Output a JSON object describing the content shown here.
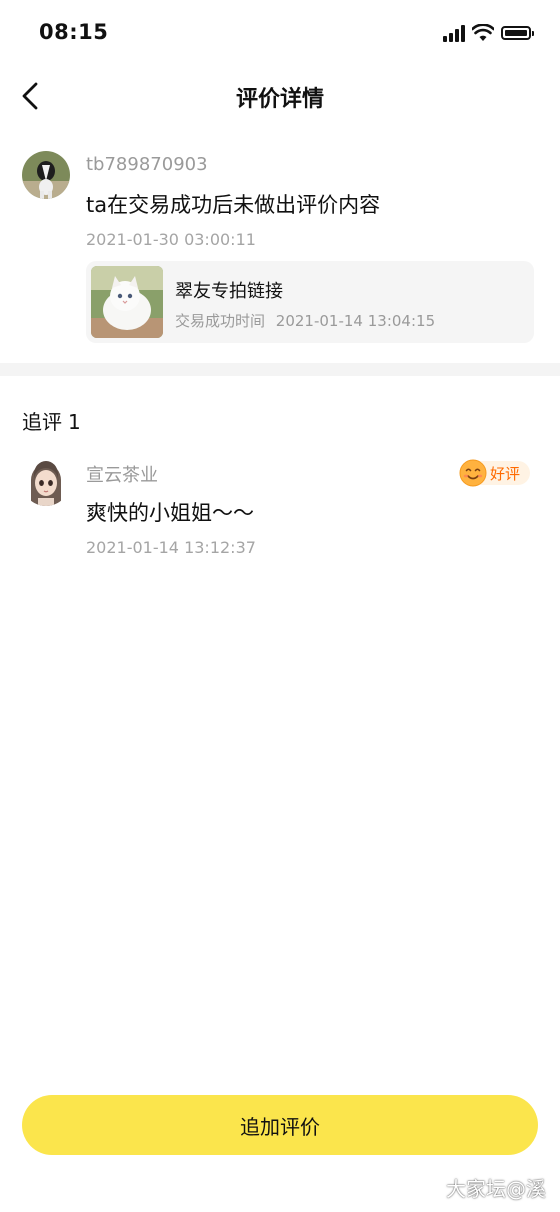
{
  "status_bar": {
    "time": "08:15"
  },
  "nav": {
    "title": "评价详情"
  },
  "review": {
    "username": "tb789870903",
    "content": "ta在交易成功后未做出评价内容",
    "time": "2021-01-30 03:00:11",
    "product": {
      "name": "翠友专拍链接",
      "trade_label": "交易成功时间",
      "trade_time": "2021-01-14 13:04:15"
    }
  },
  "followups": {
    "title": "追评",
    "count": "1",
    "items": [
      {
        "username": "宣云茶业",
        "rating": "好评",
        "content": "爽快的小姐姐～～",
        "time": "2021-01-14 13:12:37"
      }
    ]
  },
  "bottom": {
    "add_review_label": "追加评价",
    "watermark": "大家坛@溪"
  },
  "colors": {
    "accent_yellow": "#fbe54c",
    "rating_orange": "#ff6a00",
    "muted_text": "#9a9a9a"
  }
}
